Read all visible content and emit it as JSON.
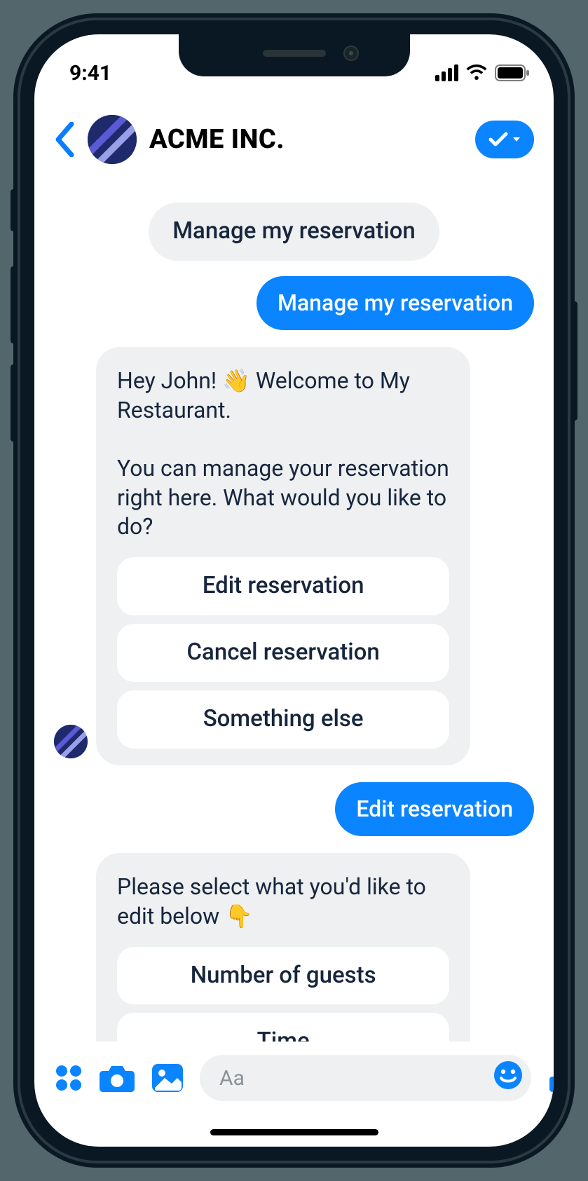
{
  "status": {
    "time": "9:41"
  },
  "header": {
    "title": "ACME INC."
  },
  "quick_reply": "Manage my reservation",
  "messages": {
    "user1": "Manage my reservation",
    "bot1_text": "Hey John! 👋 Welcome to My Restaurant.\n\nYou can manage your reservation right here. What would you like to do?",
    "bot1_options": {
      "o1": "Edit reservation",
      "o2": "Cancel reservation",
      "o3": "Something else"
    },
    "user2": "Edit reservation",
    "bot2_text": "Please select what you'd like to edit below 👇",
    "bot2_options": {
      "o1": "Number of guests",
      "o2": "Time"
    }
  },
  "compose": {
    "placeholder": "Aa"
  }
}
